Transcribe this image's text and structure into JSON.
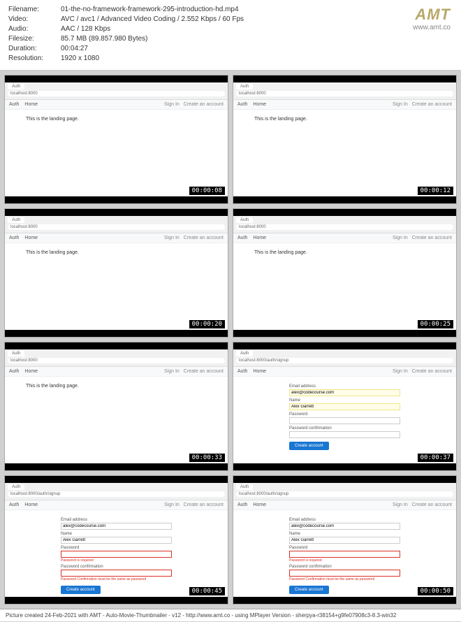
{
  "meta": {
    "labels": {
      "filename": "Filename:",
      "video": "Video:",
      "audio": "Audio:",
      "filesize": "Filesize:",
      "duration": "Duration:",
      "resolution": "Resolution:"
    },
    "filename": "01-the-no-framework-framework-295-introduction-hd.mp4",
    "video": "AVC / avc1 / Advanced Video Coding / 2.552 Kbps / 60 Fps",
    "audio": "AAC / 128 Kbps",
    "filesize": "85.7 MB (89.857.980 Bytes)",
    "duration": "00:04:27",
    "resolution": "1920 x 1080"
  },
  "logo": {
    "text": "AMT",
    "url": "www.amt.co"
  },
  "browser": {
    "tab": "Auth",
    "url_home": "localhost:8000",
    "url_signup": "localhost:8000/auth/signup"
  },
  "nav": {
    "brand": "Auth",
    "home": "Home",
    "signin": "Sign In",
    "create": "Create an account"
  },
  "landing": "This is the landing page.",
  "form": {
    "email_label": "Email address",
    "email_value": "alex@codecourse.com",
    "name_label": "Name",
    "name_value": "Alex Garrett",
    "password_label": "Password",
    "confirm_label": "Password confirmation",
    "button": "Create account",
    "err_required": "Password is required",
    "err_confirm": "Password Confirmation must be the same as password"
  },
  "timestamps": [
    "00:00:08",
    "00:00:12",
    "00:00:20",
    "00:00:25",
    "00:00:33",
    "00:00:37",
    "00:00:45",
    "00:00:50"
  ],
  "footer": "Picture created 24-Feb-2021 with AMT - Auto-Movie-Thumbnailer - v12 - http://www.amt.co - using MPlayer Version - sherpya-r38154+g9fe07908c3-8.3-win32"
}
